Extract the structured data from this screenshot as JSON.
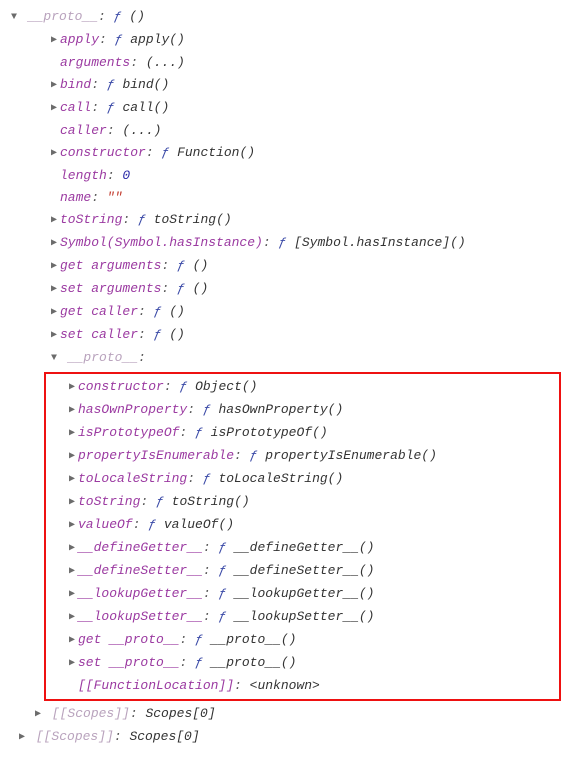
{
  "glyph_f": "ƒ",
  "sep": ": ",
  "header": {
    "key": "__proto__",
    "val": "()"
  },
  "level1": [
    {
      "arrow": "closed",
      "key": "apply",
      "faint": false,
      "kind": "fn",
      "val": "apply()"
    },
    {
      "arrow": "none",
      "key": "arguments",
      "faint": false,
      "kind": "plain",
      "val": "(...)"
    },
    {
      "arrow": "closed",
      "key": "bind",
      "faint": false,
      "kind": "fn",
      "val": "bind()"
    },
    {
      "arrow": "closed",
      "key": "call",
      "faint": false,
      "kind": "fn",
      "val": "call()"
    },
    {
      "arrow": "none",
      "key": "caller",
      "faint": false,
      "kind": "plain",
      "val": "(...)"
    },
    {
      "arrow": "closed",
      "key": "constructor",
      "faint": false,
      "kind": "fn",
      "val": "Function()"
    },
    {
      "arrow": "none",
      "key": "length",
      "faint": false,
      "kind": "num",
      "val": "0"
    },
    {
      "arrow": "none",
      "key": "name",
      "faint": false,
      "kind": "str",
      "val": "\"\""
    },
    {
      "arrow": "closed",
      "key": "toString",
      "faint": false,
      "kind": "fn",
      "val": "toString()"
    },
    {
      "arrow": "closed",
      "key": "Symbol(Symbol.hasInstance)",
      "faint": false,
      "kind": "fn",
      "val": "[Symbol.hasInstance]()"
    },
    {
      "arrow": "closed",
      "key": "get arguments",
      "faint": false,
      "kind": "fn",
      "val": "()"
    },
    {
      "arrow": "closed",
      "key": "set arguments",
      "faint": false,
      "kind": "fn",
      "val": "()"
    },
    {
      "arrow": "closed",
      "key": "get caller",
      "faint": false,
      "kind": "fn",
      "val": "()"
    },
    {
      "arrow": "closed",
      "key": "set caller",
      "faint": false,
      "kind": "fn",
      "val": "()"
    }
  ],
  "proto_header": {
    "key": "__proto__",
    "val": ""
  },
  "level2": [
    {
      "arrow": "closed",
      "key": "constructor",
      "kind": "fn",
      "val": "Object()"
    },
    {
      "arrow": "closed",
      "key": "hasOwnProperty",
      "kind": "fn",
      "val": "hasOwnProperty()"
    },
    {
      "arrow": "closed",
      "key": "isPrototypeOf",
      "kind": "fn",
      "val": "isPrototypeOf()"
    },
    {
      "arrow": "closed",
      "key": "propertyIsEnumerable",
      "kind": "fn",
      "val": "propertyIsEnumerable()"
    },
    {
      "arrow": "closed",
      "key": "toLocaleString",
      "kind": "fn",
      "val": "toLocaleString()"
    },
    {
      "arrow": "closed",
      "key": "toString",
      "kind": "fn",
      "val": "toString()"
    },
    {
      "arrow": "closed",
      "key": "valueOf",
      "kind": "fn",
      "val": "valueOf()"
    },
    {
      "arrow": "closed",
      "key": "__defineGetter__",
      "kind": "fn",
      "val": "__defineGetter__()"
    },
    {
      "arrow": "closed",
      "key": "__defineSetter__",
      "kind": "fn",
      "val": "__defineSetter__()"
    },
    {
      "arrow": "closed",
      "key": "__lookupGetter__",
      "kind": "fn",
      "val": "__lookupGetter__()"
    },
    {
      "arrow": "closed",
      "key": "__lookupSetter__",
      "kind": "fn",
      "val": "__lookupSetter__()"
    },
    {
      "arrow": "closed",
      "key": "get __proto__",
      "kind": "fn",
      "val": "__proto__()"
    },
    {
      "arrow": "closed",
      "key": "set __proto__",
      "kind": "fn",
      "val": "__proto__()"
    },
    {
      "arrow": "none",
      "key": "[[FunctionLocation]]",
      "kind": "plain",
      "val": "<unknown>"
    }
  ],
  "scopes1": {
    "key": "[[Scopes]]",
    "val": "Scopes[0]"
  },
  "scopes0": {
    "key": "[[Scopes]]",
    "val": "Scopes[0]"
  }
}
